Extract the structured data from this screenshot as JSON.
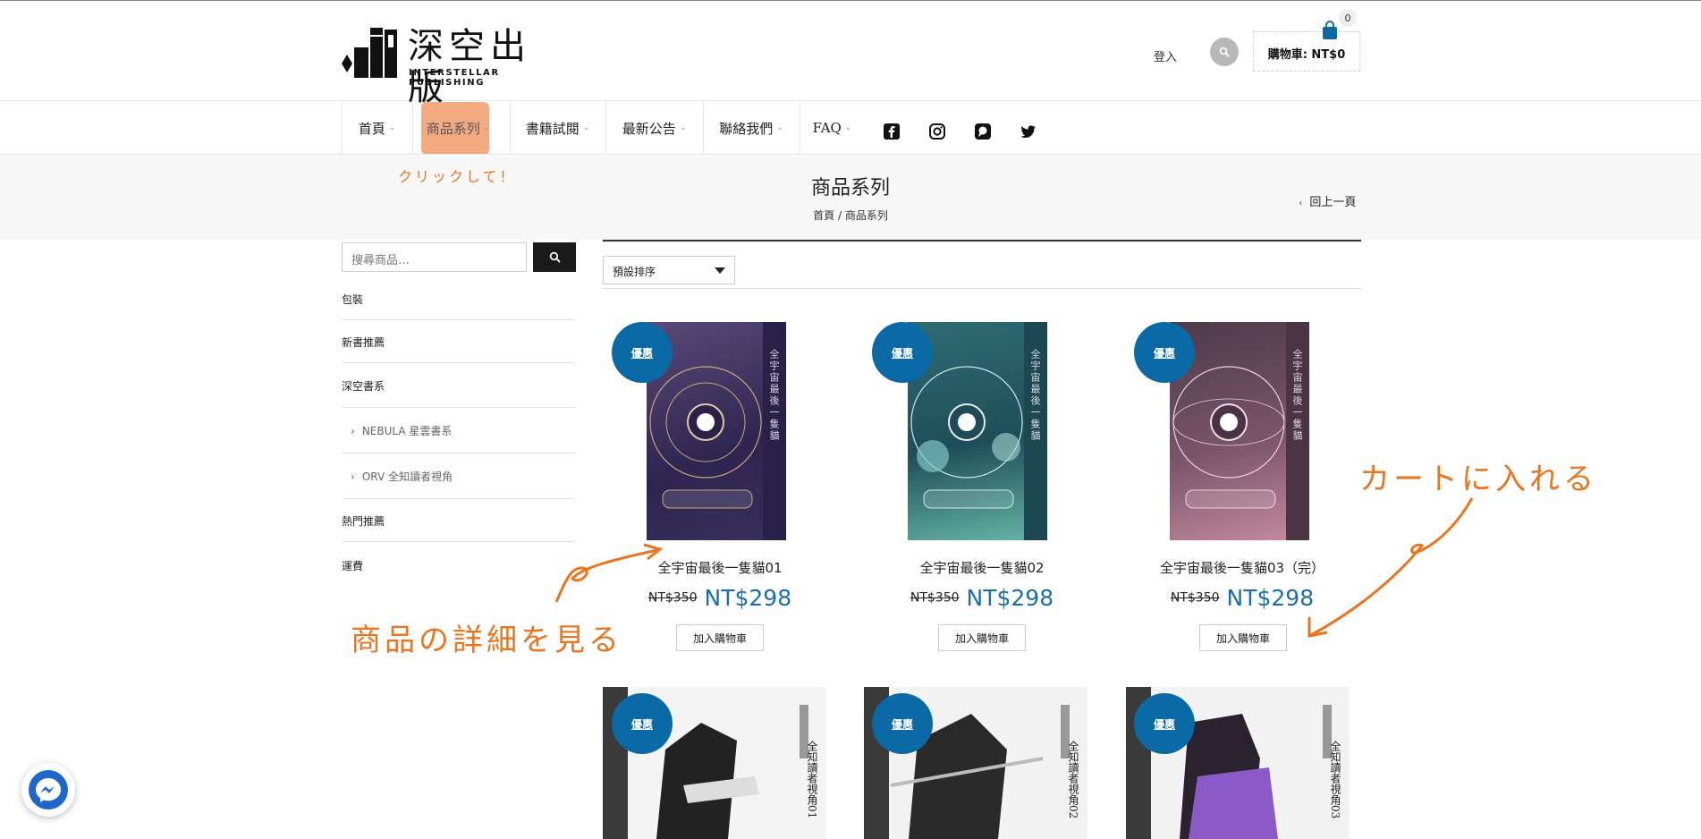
{
  "brand": {
    "name_cn": "深空出版",
    "name_en": "INTERSTELLAR PUBLISHING"
  },
  "header": {
    "login": "登入",
    "cart_label": "購物車: NT$0",
    "cart_count": "0"
  },
  "nav": {
    "items": [
      {
        "label": "首頁"
      },
      {
        "label": "商品系列"
      },
      {
        "label": "書籍試閱"
      },
      {
        "label": "最新公告"
      },
      {
        "label": "聯絡我們"
      },
      {
        "label": "FAQ"
      }
    ],
    "social_icons": [
      "facebook-icon",
      "instagram-icon",
      "plurk-icon",
      "twitter-icon"
    ]
  },
  "annotation_click": "クリックして！",
  "page": {
    "title": "商品系列",
    "breadcrumb": "首頁 / 商品系列",
    "back": "回上一頁"
  },
  "sidebar": {
    "search_placeholder": "搜尋商品…",
    "categories": [
      {
        "label": "包裝"
      },
      {
        "label": "新書推薦"
      },
      {
        "label": "深空書系"
      },
      {
        "label": "NEBULA 星雲書系"
      },
      {
        "label": "ORV 全知讀者視角"
      },
      {
        "label": "熱門推薦"
      },
      {
        "label": "運費"
      }
    ]
  },
  "toolbar": {
    "sort_label": "預設排序"
  },
  "products": [
    {
      "badge": "優惠",
      "name": "全宇宙最後一隻貓01",
      "old_price": "NT$350",
      "price": "NT$298",
      "button": "加入購物車",
      "cover_text": "全宇宙最後一隻貓"
    },
    {
      "badge": "優惠",
      "name": "全宇宙最後一隻貓02",
      "old_price": "NT$350",
      "price": "NT$298",
      "button": "加入購物車",
      "cover_text": "全宇宙最後一隻貓"
    },
    {
      "badge": "優惠",
      "name": "全宇宙最後一隻貓03（完）",
      "old_price": "NT$350",
      "price": "NT$298",
      "button": "加入購物車",
      "cover_text": "全宇宙最後一隻貓"
    },
    {
      "badge": "優惠",
      "cover_text": "全知讀者視角01"
    },
    {
      "badge": "優惠",
      "cover_text": "全知讀者視角02"
    },
    {
      "badge": "優惠",
      "cover_text": "全知讀者視角03"
    }
  ],
  "annotations": {
    "details": "商品の詳細を見る",
    "cart": "カートに入れる"
  },
  "colors": {
    "accent_blue": "#0a6aa6",
    "price_blue": "#1a6fa8",
    "annotation_orange": "#e8751f",
    "nav_highlight": "#f4aa80"
  }
}
